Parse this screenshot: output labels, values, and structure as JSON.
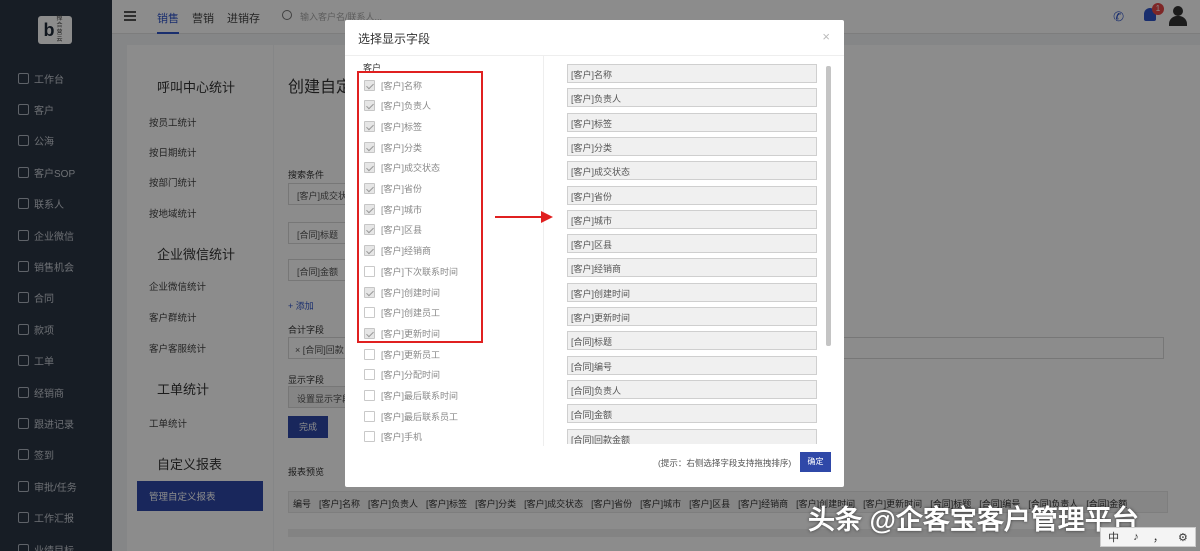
{
  "sidebar": {
    "logo_letter": "b",
    "logo_text": "掉合营云",
    "items": [
      "工作台",
      "客户",
      "公海",
      "客户SOP",
      "联系人",
      "企业微信",
      "销售机会",
      "合同",
      "款项",
      "工单",
      "经销商",
      "跟进记录",
      "签到",
      "审批/任务",
      "工作汇报",
      "业绩目标"
    ]
  },
  "topbar": {
    "tabs": [
      "销售",
      "营销",
      "进销存"
    ],
    "active_tab": "销售",
    "search_placeholder": "输入客户名/联系人...",
    "badge_count": "1"
  },
  "sub_panel": {
    "sections": [
      {
        "title": "呼叫中心统计",
        "items": [
          "按员工统计",
          "按日期统计",
          "按部门统计",
          "按地域统计"
        ]
      },
      {
        "title": "企业微信统计",
        "items": [
          "企业微信统计",
          "客户群统计",
          "客户客服统计"
        ]
      },
      {
        "title": "工单统计",
        "items": [
          "工单统计"
        ]
      },
      {
        "title": "自定义报表",
        "items": []
      }
    ],
    "active_item": "管理自定义报表"
  },
  "main": {
    "title": "创建自定",
    "search_label": "搜索条件",
    "input1": "[客户]成交状",
    "input2": "[合同]标题",
    "input3": "[合同]金额",
    "add_link": "+ 添加",
    "sum_label": "合计字段",
    "sum_tag": "× [合同]回款",
    "display_label": "显示字段",
    "display_value": "设置显示字段",
    "done_button": "完成",
    "preview_label": "报表预览",
    "table_headers": [
      "编号",
      "[客户]名称",
      "[客户]负责人",
      "[客户]标签",
      "[客户]分类",
      "[客户]成交状态",
      "[客户]省份",
      "[客户]城市",
      "[客户]区县",
      "[客户]经销商",
      "[客户]创建时间",
      "[客户]更新时间",
      "[合同]标题",
      "[合同]编号",
      "[合同]负责人",
      "[合同]金额"
    ]
  },
  "modal": {
    "title": "选择显示字段",
    "close": "×",
    "group_label": "客户",
    "left_fields": [
      {
        "label": "[客户]名称",
        "checked": true
      },
      {
        "label": "[客户]负责人",
        "checked": true
      },
      {
        "label": "[客户]标签",
        "checked": true
      },
      {
        "label": "[客户]分类",
        "checked": true
      },
      {
        "label": "[客户]成交状态",
        "checked": true
      },
      {
        "label": "[客户]省份",
        "checked": true
      },
      {
        "label": "[客户]城市",
        "checked": true
      },
      {
        "label": "[客户]区县",
        "checked": true
      },
      {
        "label": "[客户]经销商",
        "checked": true
      },
      {
        "label": "[客户]下次联系时间",
        "checked": false
      },
      {
        "label": "[客户]创建时间",
        "checked": true
      },
      {
        "label": "[客户]创建员工",
        "checked": false
      },
      {
        "label": "[客户]更新时间",
        "checked": true
      },
      {
        "label": "[客户]更新员工",
        "checked": false
      },
      {
        "label": "[客户]分配时间",
        "checked": false
      },
      {
        "label": "[客户]最后联系时间",
        "checked": false
      },
      {
        "label": "[客户]最后联系员工",
        "checked": false
      },
      {
        "label": "[客户]手机",
        "checked": false
      }
    ],
    "right_fields": [
      "[客户]名称",
      "[客户]负责人",
      "[客户]标签",
      "[客户]分类",
      "[客户]成交状态",
      "[客户]省份",
      "[客户]城市",
      "[客户]区县",
      "[客户]经销商",
      "[客户]创建时间",
      "[客户]更新时间",
      "[合同]标题",
      "[合同]编号",
      "[合同]负责人",
      "[合同]金额",
      "[合同]回款金额"
    ],
    "tip": "(提示：右侧选择字段支持拖拽排序)",
    "ok_button": "确定"
  },
  "watermark": "头条 @企客宝客户管理平台",
  "ime": [
    "中",
    "♪",
    "，",
    "⚙"
  ],
  "colors": {
    "primary": "#2f48a8",
    "sidebar": "#2b3544",
    "highlight_red": "#e02020"
  }
}
